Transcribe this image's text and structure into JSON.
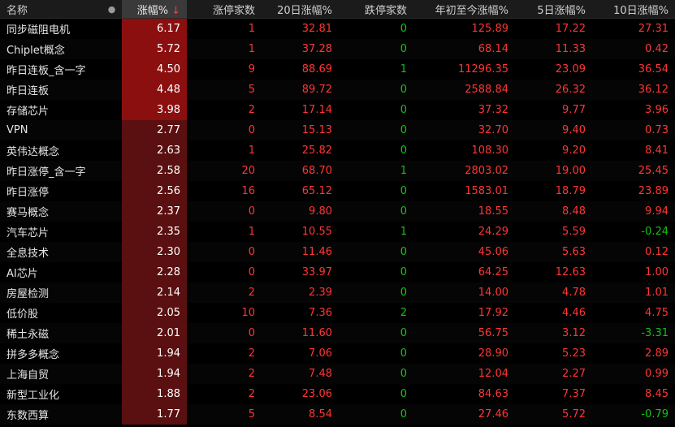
{
  "header": {
    "name": "名称",
    "dot": "●",
    "change": "涨幅%",
    "sort_arrow": "↓",
    "limit_up": "涨停家数",
    "day20": "20日涨幅%",
    "limit_down": "跌停家数",
    "ytd": "年初至今涨幅%",
    "day5": "5日涨幅%",
    "day10": "10日涨幅%"
  },
  "colors": {
    "up": "#ff3535",
    "down": "#12c312",
    "change_strong": "#8b0f0f",
    "change_weak": "#5a1010"
  },
  "rows": [
    {
      "name": "同步磁阻电机",
      "chg": "6.17",
      "lu": "1",
      "d20": "32.81",
      "ld": "0",
      "ytd": "125.89",
      "d5": "17.22",
      "d10": "27.31"
    },
    {
      "name": "Chiplet概念",
      "chg": "5.72",
      "lu": "1",
      "d20": "37.28",
      "ld": "0",
      "ytd": "68.14",
      "d5": "11.33",
      "d10": "0.42"
    },
    {
      "name": "昨日连板_含一字",
      "chg": "4.50",
      "lu": "9",
      "d20": "88.69",
      "ld": "1",
      "ytd": "11296.35",
      "d5": "23.09",
      "d10": "36.54"
    },
    {
      "name": "昨日连板",
      "chg": "4.48",
      "lu": "5",
      "d20": "89.72",
      "ld": "0",
      "ytd": "2588.84",
      "d5": "26.32",
      "d10": "36.12"
    },
    {
      "name": "存储芯片",
      "chg": "3.98",
      "lu": "2",
      "d20": "17.14",
      "ld": "0",
      "ytd": "37.32",
      "d5": "9.77",
      "d10": "3.96"
    },
    {
      "name": "VPN",
      "chg": "2.77",
      "lu": "0",
      "d20": "15.13",
      "ld": "0",
      "ytd": "32.70",
      "d5": "9.40",
      "d10": "0.73"
    },
    {
      "name": "英伟达概念",
      "chg": "2.63",
      "lu": "1",
      "d20": "25.82",
      "ld": "0",
      "ytd": "108.30",
      "d5": "9.20",
      "d10": "8.41"
    },
    {
      "name": "昨日涨停_含一字",
      "chg": "2.58",
      "lu": "20",
      "d20": "68.70",
      "ld": "1",
      "ytd": "2803.02",
      "d5": "19.00",
      "d10": "25.45"
    },
    {
      "name": "昨日涨停",
      "chg": "2.56",
      "lu": "16",
      "d20": "65.12",
      "ld": "0",
      "ytd": "1583.01",
      "d5": "18.79",
      "d10": "23.89"
    },
    {
      "name": "赛马概念",
      "chg": "2.37",
      "lu": "0",
      "d20": "9.80",
      "ld": "0",
      "ytd": "18.55",
      "d5": "8.48",
      "d10": "9.94"
    },
    {
      "name": "汽车芯片",
      "chg": "2.35",
      "lu": "1",
      "d20": "10.55",
      "ld": "1",
      "ytd": "24.29",
      "d5": "5.59",
      "d10": "-0.24"
    },
    {
      "name": "全息技术",
      "chg": "2.30",
      "lu": "0",
      "d20": "11.46",
      "ld": "0",
      "ytd": "45.06",
      "d5": "5.63",
      "d10": "0.12"
    },
    {
      "name": "AI芯片",
      "chg": "2.28",
      "lu": "0",
      "d20": "33.97",
      "ld": "0",
      "ytd": "64.25",
      "d5": "12.63",
      "d10": "1.00"
    },
    {
      "name": "房屋检测",
      "chg": "2.14",
      "lu": "2",
      "d20": "2.39",
      "ld": "0",
      "ytd": "14.00",
      "d5": "4.78",
      "d10": "1.01"
    },
    {
      "name": "低价股",
      "chg": "2.05",
      "lu": "10",
      "d20": "7.36",
      "ld": "2",
      "ytd": "17.92",
      "d5": "4.46",
      "d10": "4.75"
    },
    {
      "name": "稀土永磁",
      "chg": "2.01",
      "lu": "0",
      "d20": "11.60",
      "ld": "0",
      "ytd": "56.75",
      "d5": "3.12",
      "d10": "-3.31"
    },
    {
      "name": "拼多多概念",
      "chg": "1.94",
      "lu": "2",
      "d20": "7.06",
      "ld": "0",
      "ytd": "28.90",
      "d5": "5.23",
      "d10": "2.89"
    },
    {
      "name": "上海自贸",
      "chg": "1.94",
      "lu": "2",
      "d20": "7.48",
      "ld": "0",
      "ytd": "12.04",
      "d5": "2.27",
      "d10": "0.99"
    },
    {
      "name": "新型工业化",
      "chg": "1.88",
      "lu": "2",
      "d20": "23.06",
      "ld": "0",
      "ytd": "84.63",
      "d5": "7.37",
      "d10": "8.45"
    },
    {
      "name": "东数西算",
      "chg": "1.77",
      "lu": "5",
      "d20": "8.54",
      "ld": "0",
      "ytd": "27.46",
      "d5": "5.72",
      "d10": "-0.79"
    }
  ]
}
